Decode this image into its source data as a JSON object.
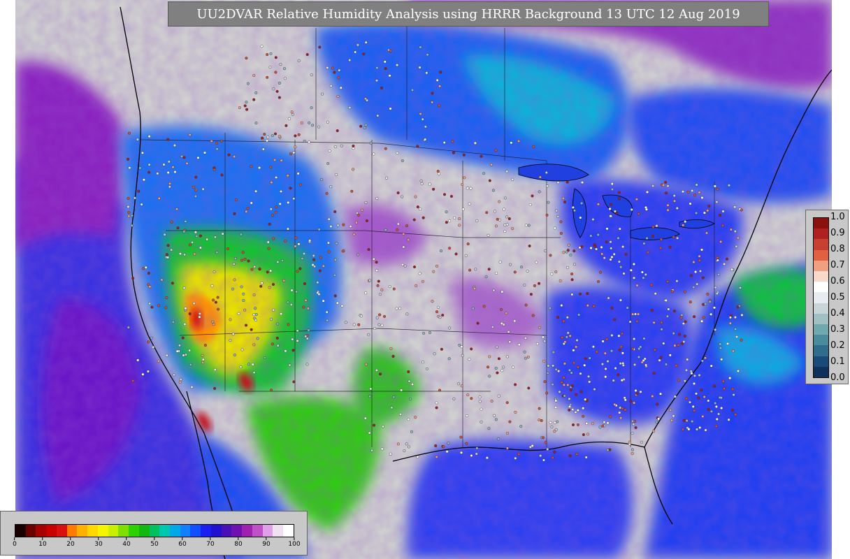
{
  "title": "UU2DVAR Relative Humidity Analysis using HRRR Background 13 UTC 12 Aug 2019",
  "rh_colorbar": {
    "ticks": [
      "0",
      "10",
      "20",
      "30",
      "40",
      "50",
      "60",
      "70",
      "80",
      "90",
      "100"
    ],
    "colors": [
      "#1a0000",
      "#6b0000",
      "#a80000",
      "#c80000",
      "#d81010",
      "#ff7a00",
      "#ffb000",
      "#ffd800",
      "#f5f500",
      "#c8f000",
      "#7fe000",
      "#2ed100",
      "#10b810",
      "#00c060",
      "#00c8b0",
      "#00a8e8",
      "#1080ff",
      "#1050ff",
      "#1a20f0",
      "#2010d0",
      "#4a10b8",
      "#7010b0",
      "#a020b0",
      "#c050c8",
      "#e0a0e8",
      "#f0e0f0",
      "#ffffff"
    ]
  },
  "fraction_colorbar": {
    "ticks": [
      "1.0",
      "0.9",
      "0.8",
      "0.7",
      "0.6",
      "0.5",
      "0.4",
      "0.3",
      "0.2",
      "0.1",
      "0.0"
    ],
    "colors": [
      "#8b1010",
      "#b02020",
      "#c84030",
      "#e06040",
      "#f0a080",
      "#f8d8c8",
      "#ffffff",
      "#e8ecf0",
      "#c8d4d8",
      "#a0c0c4",
      "#70a8b0",
      "#4a8c9c",
      "#306c8c",
      "#1a4a78",
      "#10305c"
    ]
  },
  "map": {
    "background_color": "#cfcfcf",
    "ocean_color": "#2a30f0"
  }
}
